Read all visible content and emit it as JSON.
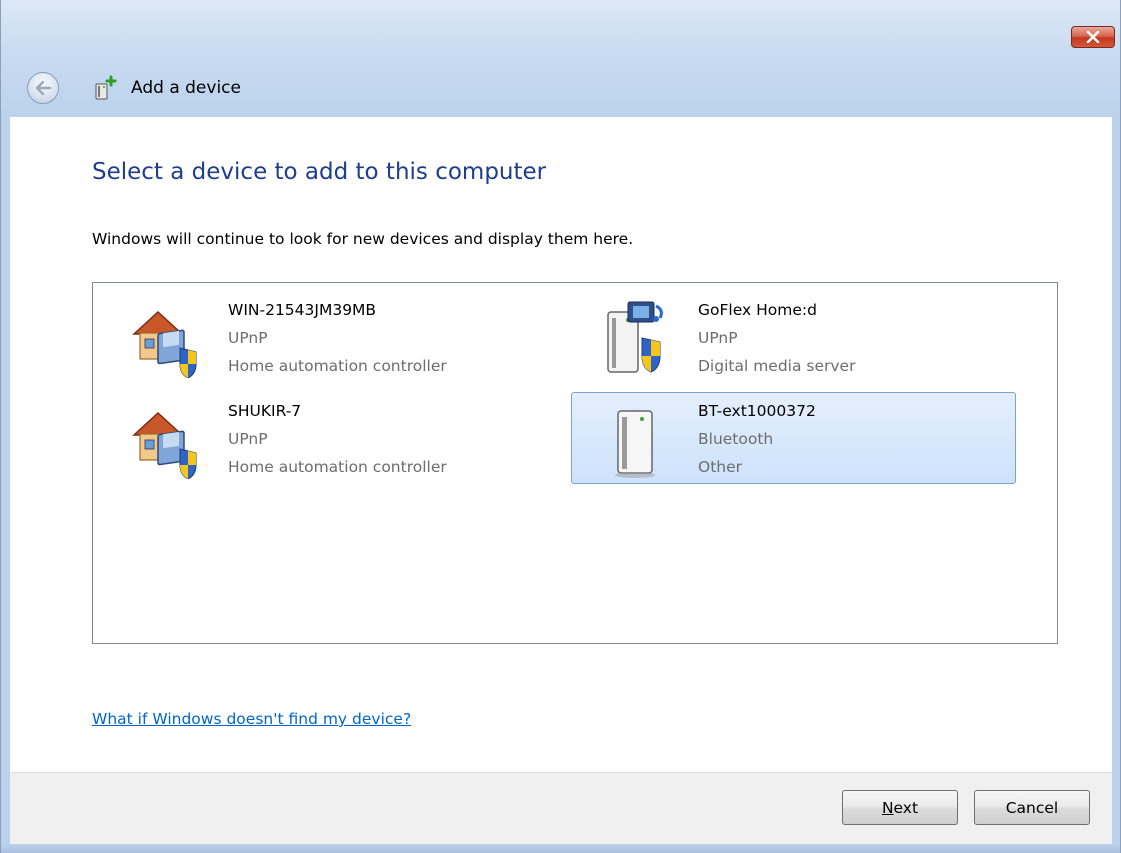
{
  "window": {
    "nav_title": "Add a device",
    "heading": "Select a device to add to this computer",
    "subtext": "Windows will continue to look for new devices and display them here."
  },
  "devices": [
    {
      "name": "WIN-21543JM39MB",
      "type": "UPnP",
      "category": "Home automation controller",
      "icon": "home-automation-icon",
      "selected": false
    },
    {
      "name": "GoFlex Home:d",
      "type": "UPnP",
      "category": "Digital media server",
      "icon": "media-server-icon",
      "selected": false
    },
    {
      "name": "SHUKIR-7",
      "type": "UPnP",
      "category": "Home automation controller",
      "icon": "home-automation-icon",
      "selected": false
    },
    {
      "name": "BT-ext1000372",
      "type": "Bluetooth",
      "category": "Other",
      "icon": "generic-device-icon",
      "selected": true
    }
  ],
  "help_link": "What if Windows doesn't find my device?",
  "buttons": {
    "next_mnemonic": "N",
    "next_rest": "ext",
    "cancel": "Cancel"
  },
  "colors": {
    "heading": "#1e3e8c",
    "link": "#0066cc",
    "selection": "#cde2fb"
  }
}
